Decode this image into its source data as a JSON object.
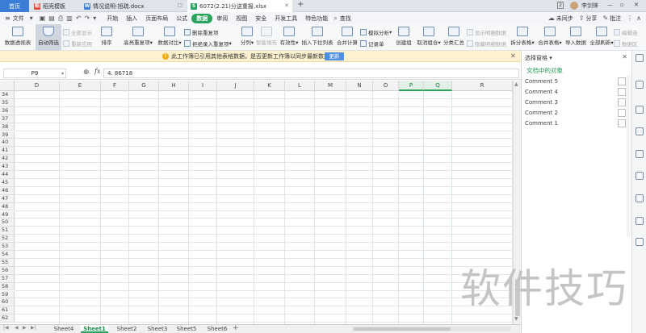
{
  "tabs": [
    {
      "label": "首页",
      "type": "home"
    },
    {
      "label": "稻壳模板",
      "icon": "稻"
    },
    {
      "label": "情况说明-旭疏.docx",
      "icon": "W"
    },
    {
      "label": "6072(2.21)分送重报.xlsx",
      "icon": "S"
    }
  ],
  "tab_badge": "2",
  "user_name": "李剑锋",
  "menu": {
    "file": "文件",
    "items": [
      "开始",
      "插入",
      "页面布局",
      "公式",
      "数据",
      "审阅",
      "视图",
      "安全",
      "开发工具",
      "特色功能"
    ],
    "active": "数据",
    "search": "查找",
    "sync": "未同步",
    "share": "分享",
    "annotate": "批注"
  },
  "ribbon": {
    "pivot": "数据透视表",
    "autofilter": "自动筛选",
    "show_all": "全部显示",
    "reapply": "重新应用",
    "sort": "排序",
    "highlight_dup": "高亮重复项",
    "compare": "数据对比",
    "remove_dup": "删除重复项",
    "reject_dup": "拒绝录入重复项",
    "split": "分列",
    "smart_fill": "智能填充",
    "validity": "有效性",
    "dropdown": "插入下拉列表",
    "merge_calc": "合并计算",
    "simulate": "模拟分析",
    "record": "记录单",
    "create_group": "创建组",
    "ungroup": "取消组合",
    "subtotal": "分类汇总",
    "show_detail": "显示明细数据",
    "hide_detail": "隐藏明细数据",
    "split_table": "拆分表格",
    "merge_table": "合并表格",
    "import": "导入数据",
    "refresh_all": "全部刷新",
    "edit_link": "编辑连",
    "data_props": "数据区"
  },
  "notice": {
    "text": "此工作簿已引用其他表格数据，是否更新工作簿以同步最新数据？",
    "button": "更新"
  },
  "namebox": "P9",
  "formula": "4. 86718",
  "columns": [
    "D",
    "E",
    "F",
    "G",
    "H",
    "I",
    "J",
    "K",
    "L",
    "M",
    "N",
    "O",
    "P",
    "Q",
    "R"
  ],
  "selected_columns": [
    "P",
    "Q"
  ],
  "rows": [
    "34",
    "35",
    "36",
    "37",
    "38",
    "39",
    "40",
    "41",
    "42",
    "43",
    "44",
    "45",
    "46",
    "47",
    "48",
    "49",
    "50",
    "51",
    "52",
    "53",
    "54",
    "55",
    "56",
    "57",
    "58",
    "59",
    "60",
    "61",
    "62"
  ],
  "sheets": [
    "Sheet4",
    "Sheet1",
    "Sheet2",
    "Sheet3",
    "Sheet5",
    "Sheet6"
  ],
  "active_sheet": "Sheet1",
  "pane": {
    "title": "选择窗格",
    "subtitle": "文档中的对象",
    "items": [
      "Comment 5",
      "Comment 4",
      "Comment 3",
      "Comment 2",
      "Comment 1"
    ]
  },
  "watermark": "软件技巧",
  "colors": {
    "accent": "#2aa35c",
    "home_tab": "#3c7dd8",
    "notice_bg": "#fdf1cf"
  }
}
